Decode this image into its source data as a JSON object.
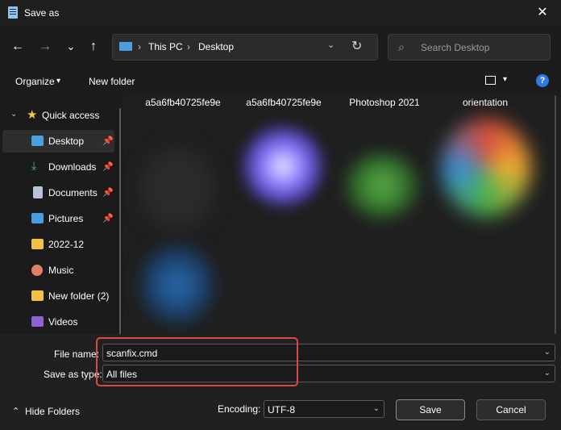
{
  "window": {
    "title": "Save as",
    "close": "✕"
  },
  "nav": {
    "back": "←",
    "forward": "→",
    "recent": "⌄",
    "up": "↑",
    "breadcrumb": [
      "This PC",
      "Desktop"
    ],
    "separator": "›",
    "dropdown": "⌄",
    "refresh": "↻",
    "search_placeholder": "Search Desktop",
    "search_icon": "⌕"
  },
  "toolbar": {
    "organize": "Organize",
    "organize_chev": "▾",
    "new_folder": "New folder",
    "view_chev": "▾",
    "help": "?"
  },
  "sidebar": {
    "quick_access": "Quick access",
    "items": [
      {
        "label": "Desktop",
        "pinned": true,
        "icon": "desktop-icon",
        "color": "#4aa0de"
      },
      {
        "label": "Downloads",
        "pinned": true,
        "icon": "download-icon",
        "color": "#3fbf8f"
      },
      {
        "label": "Documents",
        "pinned": true,
        "icon": "documents-icon",
        "color": "#b8c4d4"
      },
      {
        "label": "Pictures",
        "pinned": true,
        "icon": "pictures-icon",
        "color": "#4a9de0"
      },
      {
        "label": "2022-12",
        "pinned": false,
        "icon": "folder-icon",
        "color": "#f3c14b"
      },
      {
        "label": "Music",
        "pinned": false,
        "icon": "music-icon",
        "color": "#e0806a"
      },
      {
        "label": "New folder (2)",
        "pinned": false,
        "icon": "folder-icon",
        "color": "#f3c14b"
      },
      {
        "label": "Videos",
        "pinned": false,
        "icon": "videos-icon",
        "color": "#8a63d2"
      }
    ],
    "pin": "📌"
  },
  "files": [
    {
      "name": "a5a6fb40725fe9e"
    },
    {
      "name": "a5a6fb40725fe9e"
    },
    {
      "name": "Photoshop 2021"
    },
    {
      "name": "orientation"
    }
  ],
  "form": {
    "file_name_label": "File name:",
    "file_name_value": "scanfix.cmd",
    "save_type_label": "Save as type:",
    "save_type_value": "All files",
    "encoding_label": "Encoding:",
    "encoding_value": "UTF-8",
    "chev": "⌄"
  },
  "footer": {
    "hide_folders": "Hide Folders",
    "hide_chev": "⌃",
    "save": "Save",
    "cancel": "Cancel"
  },
  "colors": {
    "highlight": "#d94a45",
    "accent": "#2d7ae0"
  }
}
